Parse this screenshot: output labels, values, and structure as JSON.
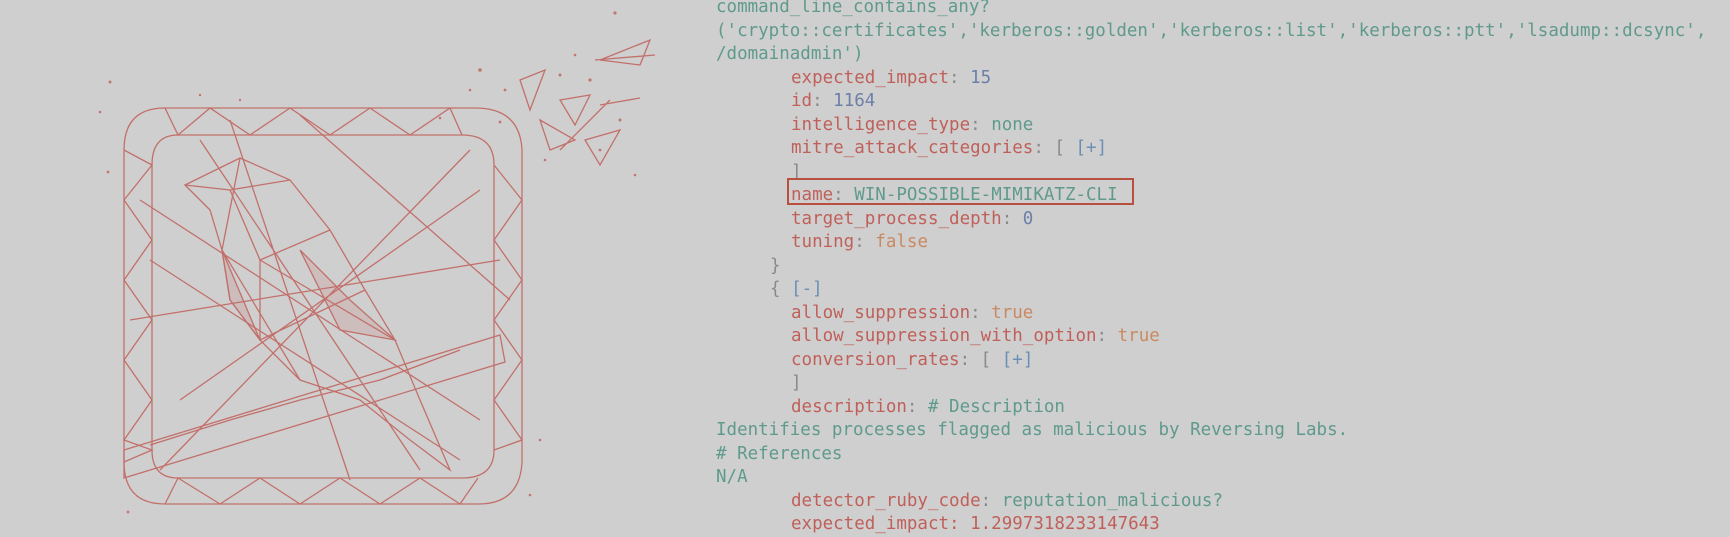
{
  "colors": {
    "background": "#cfcfcf",
    "key": "#c0605a",
    "string_value": "#5f9a8c",
    "number_value": "#6b7fa8",
    "boolean_value": "#c98a62",
    "link": "#6c8fb5",
    "highlight_box": "#b9503f",
    "logo": "#c0605a"
  },
  "logo": {
    "icon": "polygonal-bird-logo-icon"
  },
  "code": {
    "cmd_line": "command_line_contains_any?",
    "cmd_args": "('crypto::certificates','kerberos::golden','kerberos::list','kerberos::ptt','lsadump::dcsync',",
    "cmd_tail": "/domainadmin')",
    "expected_impact": {
      "key": "expected_impact",
      "value": "15"
    },
    "id": {
      "key": "id",
      "value": "1164"
    },
    "intelligence_type": {
      "key": "intelligence_type",
      "value": "none"
    },
    "mitre": {
      "key": "mitre_attack_categories",
      "open": "[",
      "expand": "[+]",
      "close": "]"
    },
    "name": {
      "key": "name",
      "value": "WIN-POSSIBLE-MIMIKATZ-CLI"
    },
    "target_process_depth": {
      "key": "target_process_depth",
      "value": "0"
    },
    "tuning": {
      "key": "tuning",
      "value": "false"
    },
    "close_brace": "}",
    "open_brace": "{",
    "collapse": "[-]",
    "allow_suppression": {
      "key": "allow_suppression",
      "value": "true"
    },
    "allow_suppression_with_option": {
      "key": "allow_suppression_with_option",
      "value": "true"
    },
    "conversion_rates": {
      "key": "conversion_rates",
      "open": "[",
      "expand": "[+]",
      "close": "]"
    },
    "description": {
      "key": "description",
      "value": "# Description"
    },
    "desc_text": "Identifies processes flagged as malicious by Reversing Labs.",
    "references_heading": "# References",
    "references_value": "N/A",
    "detector_ruby_code": {
      "key": "detector_ruby_code",
      "value": "reputation_malicious?"
    },
    "last_partial": "expected_impact: 1.2997318233147643"
  }
}
